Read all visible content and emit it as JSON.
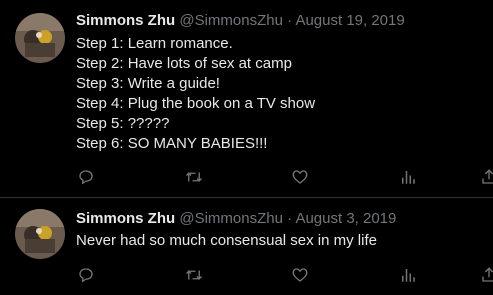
{
  "colors": {
    "background": "#000000",
    "text_primary": "#e7e9ea",
    "text_secondary": "#71767b",
    "divider": "#2f3336"
  },
  "tweets": [
    {
      "author": {
        "display_name": "Simmons Zhu",
        "handle": "@SimmonsZhu"
      },
      "separator": "·",
      "date": "August 19, 2019",
      "lines": [
        "Step 1: Learn romance.",
        "Step 2: Have lots of sex at camp",
        "Step 3: Write a guide!",
        "Step 4: Plug the book on a TV show",
        "Step 5: ?????",
        "Step 6: SO MANY BABIES!!!"
      ],
      "actions": [
        "reply-icon",
        "retweet-icon",
        "like-icon",
        "views-icon",
        "share-icon"
      ]
    },
    {
      "author": {
        "display_name": "Simmons Zhu",
        "handle": "@SimmonsZhu"
      },
      "separator": "·",
      "date": "August 3, 2019",
      "lines": [
        "Never had so much consensual sex in my life"
      ],
      "actions": [
        "reply-icon",
        "retweet-icon",
        "like-icon",
        "views-icon",
        "share-icon"
      ]
    }
  ]
}
